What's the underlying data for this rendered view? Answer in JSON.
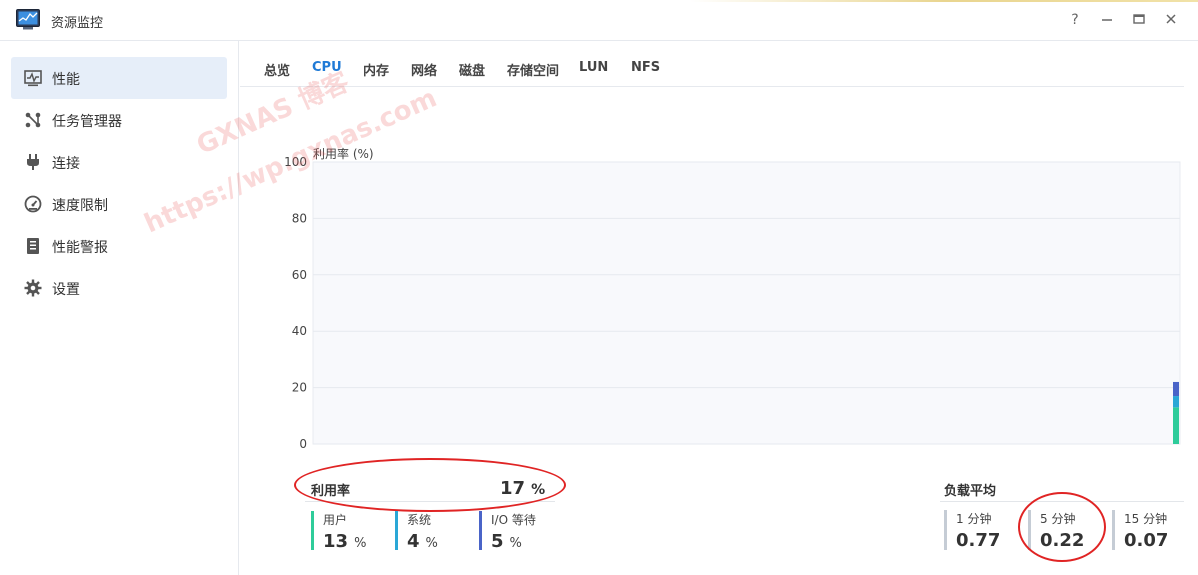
{
  "window": {
    "title": "资源监控",
    "help_symbol": "?",
    "minimize_symbol": "–",
    "maximize_symbol": "□",
    "close_symbol": "✕"
  },
  "sidebar": {
    "items": [
      {
        "label": "性能",
        "icon": "performance-icon",
        "active": true
      },
      {
        "label": "任务管理器",
        "icon": "task-manager-icon",
        "active": false
      },
      {
        "label": "连接",
        "icon": "plug-icon",
        "active": false
      },
      {
        "label": "速度限制",
        "icon": "speedometer-icon",
        "active": false
      },
      {
        "label": "性能警报",
        "icon": "alert-report-icon",
        "active": false
      },
      {
        "label": "设置",
        "icon": "gear-icon",
        "active": false
      }
    ]
  },
  "tabs": [
    {
      "label": "总览",
      "active": false
    },
    {
      "label": "CPU",
      "active": true
    },
    {
      "label": "内存",
      "active": false
    },
    {
      "label": "网络",
      "active": false
    },
    {
      "label": "磁盘",
      "active": false
    },
    {
      "label": "存储空间",
      "active": false
    },
    {
      "label": "LUN",
      "active": false
    },
    {
      "label": "NFS",
      "active": false
    }
  ],
  "chart_data": {
    "type": "area",
    "title": "利用率 (%)",
    "ylim": [
      0,
      100
    ],
    "yticks": [
      "100",
      "80",
      "60",
      "40",
      "20",
      "0"
    ],
    "grid": true,
    "series": [
      {
        "name": "用户",
        "color": "#2ecc9a",
        "values": [
          13
        ]
      },
      {
        "name": "系统",
        "color": "#2aa7d6",
        "values": [
          4
        ]
      },
      {
        "name": "I/O 等待",
        "color": "#4a64c8",
        "values": [
          5
        ]
      }
    ]
  },
  "utilization": {
    "label": "利用率",
    "value": "17",
    "unit": "%",
    "breakdown": [
      {
        "label": "用户",
        "value": "13",
        "unit": "%",
        "color": "#2ecc9a"
      },
      {
        "label": "系统",
        "value": "4",
        "unit": "%",
        "color": "#2aa7d6"
      },
      {
        "label": "I/O 等待",
        "value": "5",
        "unit": "%",
        "color": "#4a64c8"
      }
    ]
  },
  "load_average": {
    "label": "负载平均",
    "items": [
      {
        "label": "1 分钟",
        "value": "0.77"
      },
      {
        "label": "5 分钟",
        "value": "0.22"
      },
      {
        "label": "15 分钟",
        "value": "0.07"
      }
    ]
  },
  "watermark": {
    "line1": "GXNAS 博客",
    "line2": "https://wp.gxnas.com"
  }
}
